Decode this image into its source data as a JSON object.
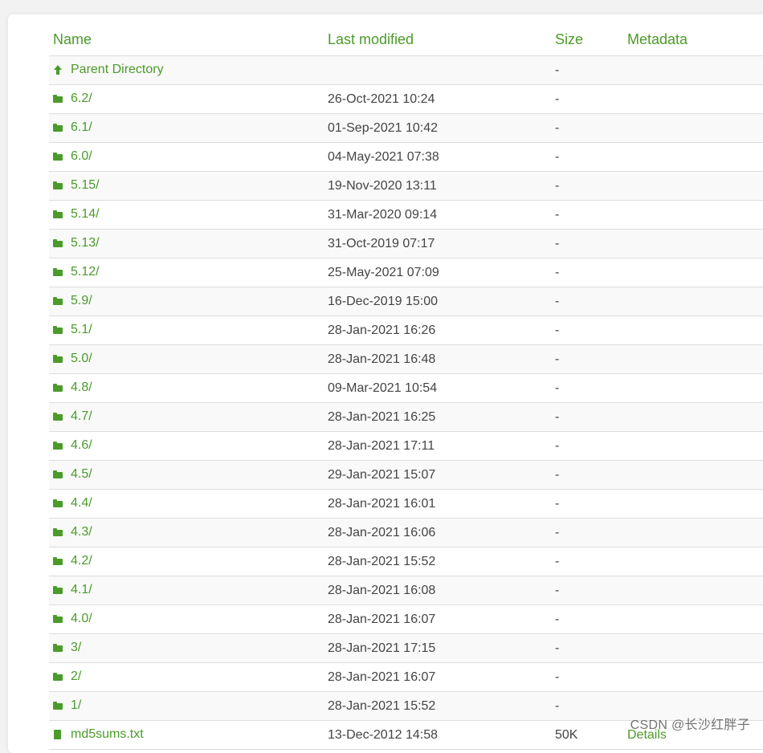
{
  "headers": {
    "name": "Name",
    "last_modified": "Last modified",
    "size": "Size",
    "metadata": "Metadata"
  },
  "rows": [
    {
      "name": "Parent Directory",
      "date": "",
      "size": "-",
      "meta": "",
      "icon": "arrow-up-icon"
    },
    {
      "name": "6.2/",
      "date": "26-Oct-2021 10:24",
      "size": "-",
      "meta": "",
      "icon": "folder-icon"
    },
    {
      "name": "6.1/",
      "date": "01-Sep-2021 10:42",
      "size": "-",
      "meta": "",
      "icon": "folder-icon"
    },
    {
      "name": "6.0/",
      "date": "04-May-2021 07:38",
      "size": "-",
      "meta": "",
      "icon": "folder-icon"
    },
    {
      "name": "5.15/",
      "date": "19-Nov-2020 13:11",
      "size": "-",
      "meta": "",
      "icon": "folder-icon"
    },
    {
      "name": "5.14/",
      "date": "31-Mar-2020 09:14",
      "size": "-",
      "meta": "",
      "icon": "folder-icon"
    },
    {
      "name": "5.13/",
      "date": "31-Oct-2019 07:17",
      "size": "-",
      "meta": "",
      "icon": "folder-icon"
    },
    {
      "name": "5.12/",
      "date": "25-May-2021 07:09",
      "size": "-",
      "meta": "",
      "icon": "folder-icon"
    },
    {
      "name": "5.9/",
      "date": "16-Dec-2019 15:00",
      "size": "-",
      "meta": "",
      "icon": "folder-icon"
    },
    {
      "name": "5.1/",
      "date": "28-Jan-2021 16:26",
      "size": "-",
      "meta": "",
      "icon": "folder-icon"
    },
    {
      "name": "5.0/",
      "date": "28-Jan-2021 16:48",
      "size": "-",
      "meta": "",
      "icon": "folder-icon"
    },
    {
      "name": "4.8/",
      "date": "09-Mar-2021 10:54",
      "size": "-",
      "meta": "",
      "icon": "folder-icon"
    },
    {
      "name": "4.7/",
      "date": "28-Jan-2021 16:25",
      "size": "-",
      "meta": "",
      "icon": "folder-icon"
    },
    {
      "name": "4.6/",
      "date": "28-Jan-2021 17:11",
      "size": "-",
      "meta": "",
      "icon": "folder-icon"
    },
    {
      "name": "4.5/",
      "date": "29-Jan-2021 15:07",
      "size": "-",
      "meta": "",
      "icon": "folder-icon"
    },
    {
      "name": "4.4/",
      "date": "28-Jan-2021 16:01",
      "size": "-",
      "meta": "",
      "icon": "folder-icon"
    },
    {
      "name": "4.3/",
      "date": "28-Jan-2021 16:06",
      "size": "-",
      "meta": "",
      "icon": "folder-icon"
    },
    {
      "name": "4.2/",
      "date": "28-Jan-2021 15:52",
      "size": "-",
      "meta": "",
      "icon": "folder-icon"
    },
    {
      "name": "4.1/",
      "date": "28-Jan-2021 16:08",
      "size": "-",
      "meta": "",
      "icon": "folder-icon"
    },
    {
      "name": "4.0/",
      "date": "28-Jan-2021 16:07",
      "size": "-",
      "meta": "",
      "icon": "folder-icon"
    },
    {
      "name": "3/",
      "date": "28-Jan-2021 17:15",
      "size": "-",
      "meta": "",
      "icon": "folder-icon"
    },
    {
      "name": "2/",
      "date": "28-Jan-2021 16:07",
      "size": "-",
      "meta": "",
      "icon": "folder-icon"
    },
    {
      "name": "1/",
      "date": "28-Jan-2021 15:52",
      "size": "-",
      "meta": "",
      "icon": "folder-icon"
    },
    {
      "name": "md5sums.txt",
      "date": "13-Dec-2012 14:58",
      "size": "50K",
      "meta": "Details",
      "icon": "file-icon"
    }
  ],
  "watermark": "CSDN @长沙红胖子",
  "colors": {
    "accent": "#4b9b2a",
    "text": "#444444",
    "row_alt": "#f9f9f9",
    "border": "#dddddd"
  }
}
